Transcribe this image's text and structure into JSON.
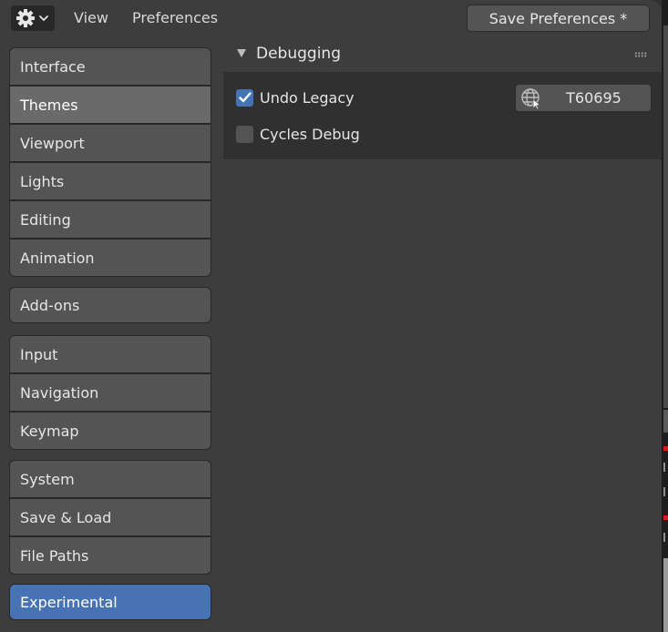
{
  "header": {
    "editor_type_icon": "gear-icon",
    "menus": [
      "View",
      "Preferences"
    ],
    "save_button": "Save Preferences *"
  },
  "sidebar": {
    "groups": [
      [
        {
          "label": "Interface"
        },
        {
          "label": "Themes",
          "state": "hover"
        },
        {
          "label": "Viewport"
        },
        {
          "label": "Lights"
        },
        {
          "label": "Editing"
        },
        {
          "label": "Animation"
        }
      ],
      [
        {
          "label": "Add-ons"
        }
      ],
      [
        {
          "label": "Input"
        },
        {
          "label": "Navigation"
        },
        {
          "label": "Keymap"
        }
      ],
      [
        {
          "label": "System"
        },
        {
          "label": "Save & Load"
        },
        {
          "label": "File Paths"
        }
      ],
      [
        {
          "label": "Experimental",
          "state": "active"
        }
      ]
    ]
  },
  "main": {
    "panel": {
      "title": "Debugging",
      "expanded": true,
      "properties": [
        {
          "label": "Undo Legacy",
          "checked": true,
          "link": {
            "icon": "url-icon",
            "label": "T60695"
          }
        },
        {
          "label": "Cycles Debug",
          "checked": false
        }
      ]
    }
  },
  "colors": {
    "accent": "#4772b3",
    "background": "#3d3d3d",
    "panel_body": "#303030",
    "widget": "#545454",
    "hover": "#6a6a6a"
  }
}
